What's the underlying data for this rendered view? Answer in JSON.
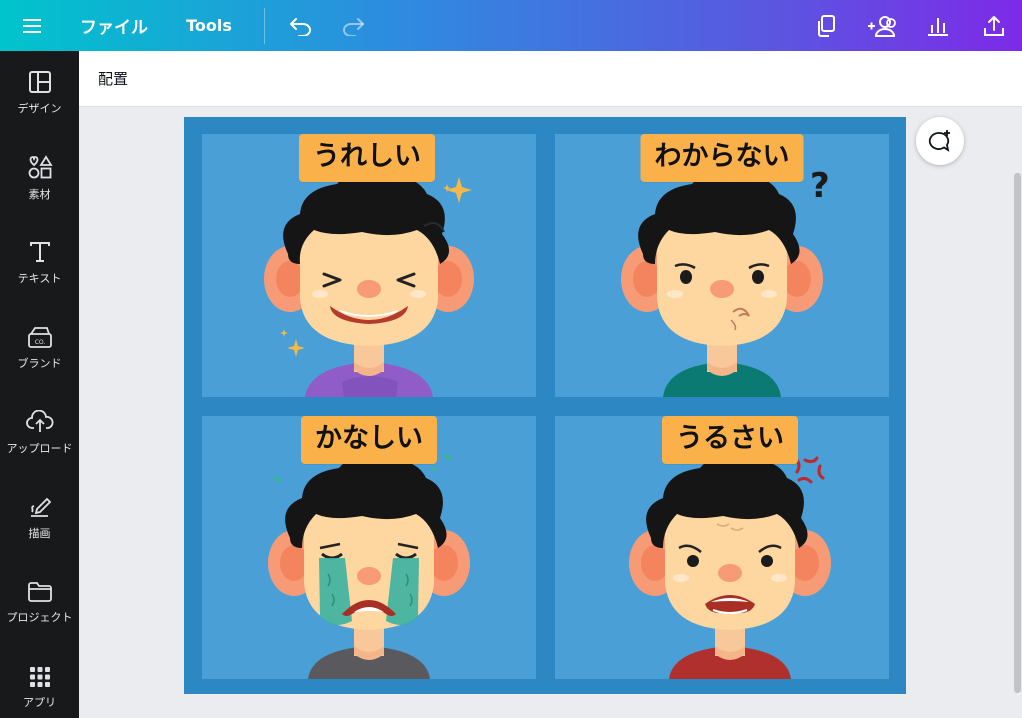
{
  "topbar": {
    "file_label": "ファイル",
    "tools_label": "Tools",
    "icons": [
      "menu-icon",
      "undo-icon",
      "redo-icon",
      "copy-icon",
      "add-person-icon",
      "insights-icon",
      "share-upload-icon"
    ]
  },
  "sidebar": {
    "items": [
      {
        "label": "デザイン",
        "icon": "template-icon"
      },
      {
        "label": "素材",
        "icon": "elements-icon"
      },
      {
        "label": "テキスト",
        "icon": "text-icon"
      },
      {
        "label": "ブランド",
        "icon": "brand-icon"
      },
      {
        "label": "アップロード",
        "icon": "upload-icon"
      },
      {
        "label": "描画",
        "icon": "draw-icon"
      },
      {
        "label": "プロジェクト",
        "icon": "folder-icon"
      },
      {
        "label": "アプリ",
        "icon": "apps-icon"
      }
    ]
  },
  "context_toolbar": {
    "arrange_label": "配置"
  },
  "design": {
    "panels": [
      {
        "label": "うれしい",
        "shirt_color": "#8f5cc8"
      },
      {
        "label": "わからない",
        "shirt_color": "#0b7a73"
      },
      {
        "label": "かなしい",
        "shirt_color": "#5a5a5e"
      },
      {
        "label": "うるさい",
        "shirt_color": "#b0302e"
      }
    ]
  },
  "colors": {
    "topbar_start": "#00c4cc",
    "topbar_end": "#7d2ae8",
    "sidebar_bg": "#18191b",
    "design_bg": "#2d87c3",
    "panel_bg": "#4a9fd6",
    "label_bg": "#fbb14a"
  }
}
